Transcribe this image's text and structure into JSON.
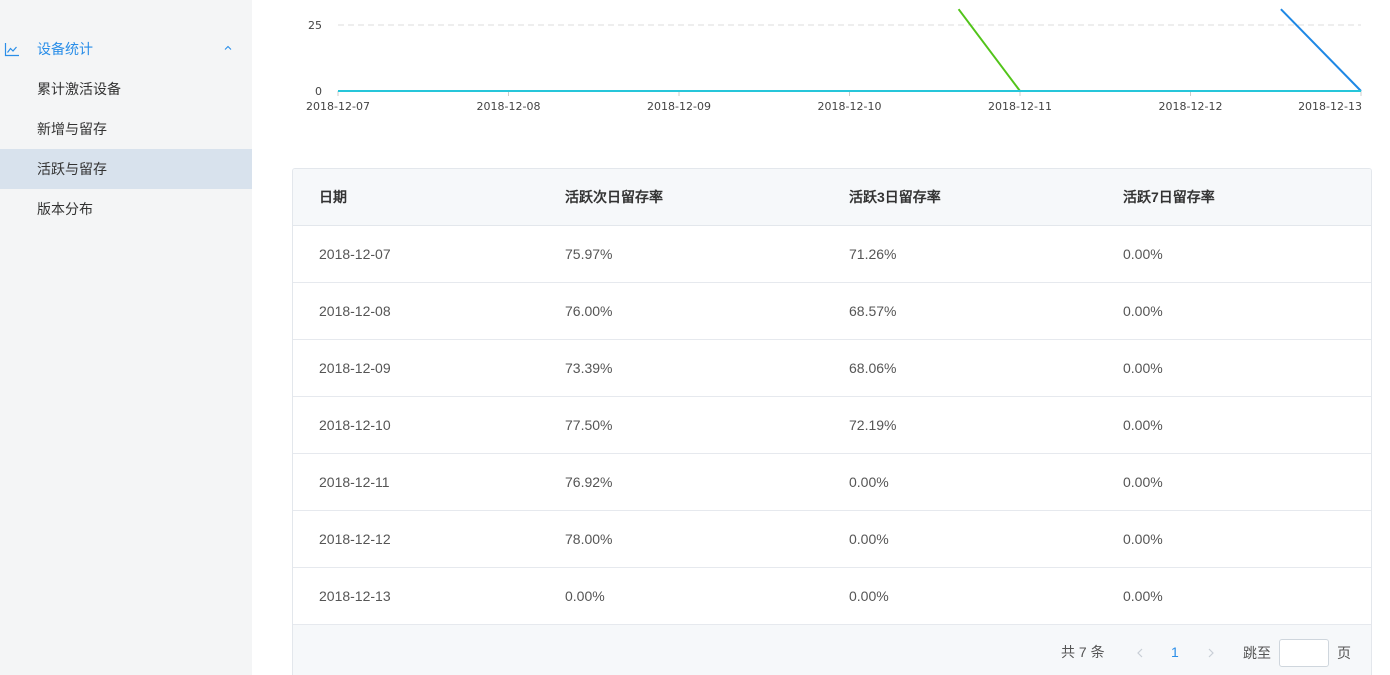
{
  "sidebar": {
    "group": {
      "label": "设备统计",
      "icon": "line-chart-icon",
      "expanded": true
    },
    "items": [
      {
        "label": "累计激活设备",
        "active": false
      },
      {
        "label": "新增与留存",
        "active": false
      },
      {
        "label": "活跃与留存",
        "active": true
      },
      {
        "label": "版本分布",
        "active": false
      }
    ]
  },
  "chart_data": {
    "type": "line",
    "x": [
      "2018-12-07",
      "2018-12-08",
      "2018-12-09",
      "2018-12-10",
      "2018-12-11",
      "2018-12-12",
      "2018-12-13"
    ],
    "y_ticks_visible": [
      0,
      25
    ],
    "ylim_visible": [
      0,
      30
    ],
    "grid": "horizontal dashed",
    "series": [
      {
        "color": "#52c41a",
        "values": [
          null,
          null,
          null,
          null,
          0,
          0,
          0
        ],
        "note_visible_segment_from": {
          "x": 3.64,
          "y": 31
        }
      },
      {
        "color": "#1e88e5",
        "values": [
          null,
          null,
          null,
          null,
          null,
          null,
          0
        ],
        "note_visible_segment_from": {
          "x": 5.53,
          "y": 31
        }
      },
      {
        "color": "#26c6da",
        "values": [
          0,
          0,
          0,
          0,
          0,
          0,
          0
        ]
      }
    ]
  },
  "table": {
    "columns": [
      "日期",
      "活跃次日留存率",
      "活跃3日留存率",
      "活跃7日留存率"
    ],
    "rows": [
      [
        "2018-12-07",
        "75.97%",
        "71.26%",
        "0.00%"
      ],
      [
        "2018-12-08",
        "76.00%",
        "68.57%",
        "0.00%"
      ],
      [
        "2018-12-09",
        "73.39%",
        "68.06%",
        "0.00%"
      ],
      [
        "2018-12-10",
        "77.50%",
        "72.19%",
        "0.00%"
      ],
      [
        "2018-12-11",
        "76.92%",
        "0.00%",
        "0.00%"
      ],
      [
        "2018-12-12",
        "78.00%",
        "0.00%",
        "0.00%"
      ],
      [
        "2018-12-13",
        "0.00%",
        "0.00%",
        "0.00%"
      ]
    ]
  },
  "pagination": {
    "total_text": "共 7 条",
    "current_page": "1",
    "jump_label": "跳至",
    "jump_value": "",
    "page_unit": "页"
  },
  "colors": {
    "accent": "#2a8ee8",
    "sidebar_bg": "#f4f5f6",
    "sidebar_active_bg": "#d8e2ed",
    "table_header_bg": "#f6f8fa"
  }
}
